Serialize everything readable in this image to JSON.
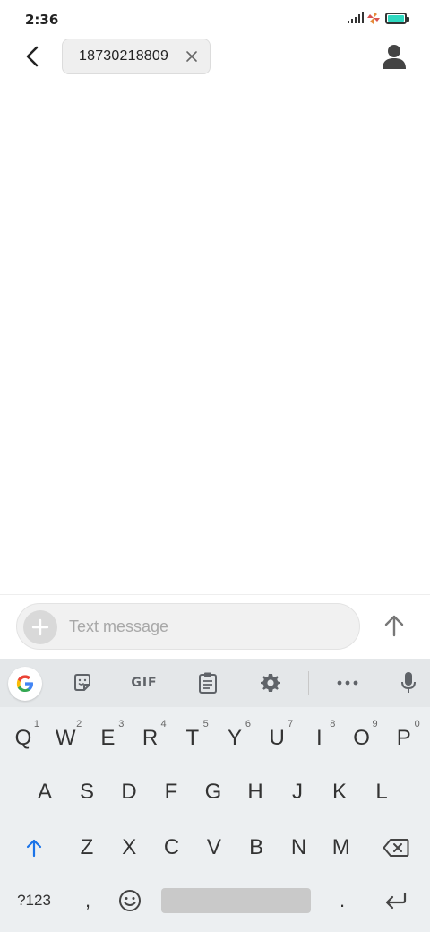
{
  "status_bar": {
    "time": "2:36"
  },
  "header": {
    "recipient": "18730218809",
    "back_icon": "back-arrow-icon",
    "contact_icon": "person-icon"
  },
  "compose": {
    "placeholder": "Text message",
    "value": ""
  },
  "keyboard": {
    "toolbar": {
      "gif_label": "GIF"
    },
    "row1": [
      {
        "label": "Q",
        "hint": "1"
      },
      {
        "label": "W",
        "hint": "2"
      },
      {
        "label": "E",
        "hint": "3"
      },
      {
        "label": "R",
        "hint": "4"
      },
      {
        "label": "T",
        "hint": "5"
      },
      {
        "label": "Y",
        "hint": "6"
      },
      {
        "label": "U",
        "hint": "7"
      },
      {
        "label": "I",
        "hint": "8"
      },
      {
        "label": "O",
        "hint": "9"
      },
      {
        "label": "P",
        "hint": "0"
      }
    ],
    "row2": [
      "A",
      "S",
      "D",
      "F",
      "G",
      "H",
      "J",
      "K",
      "L"
    ],
    "row3": [
      "Z",
      "X",
      "C",
      "V",
      "B",
      "N",
      "M"
    ],
    "row4": {
      "symbols": "?123",
      "comma": ",",
      "period": "."
    }
  },
  "colors": {
    "battery": "#2fd8c0",
    "shift_accent": "#1a73e8"
  }
}
